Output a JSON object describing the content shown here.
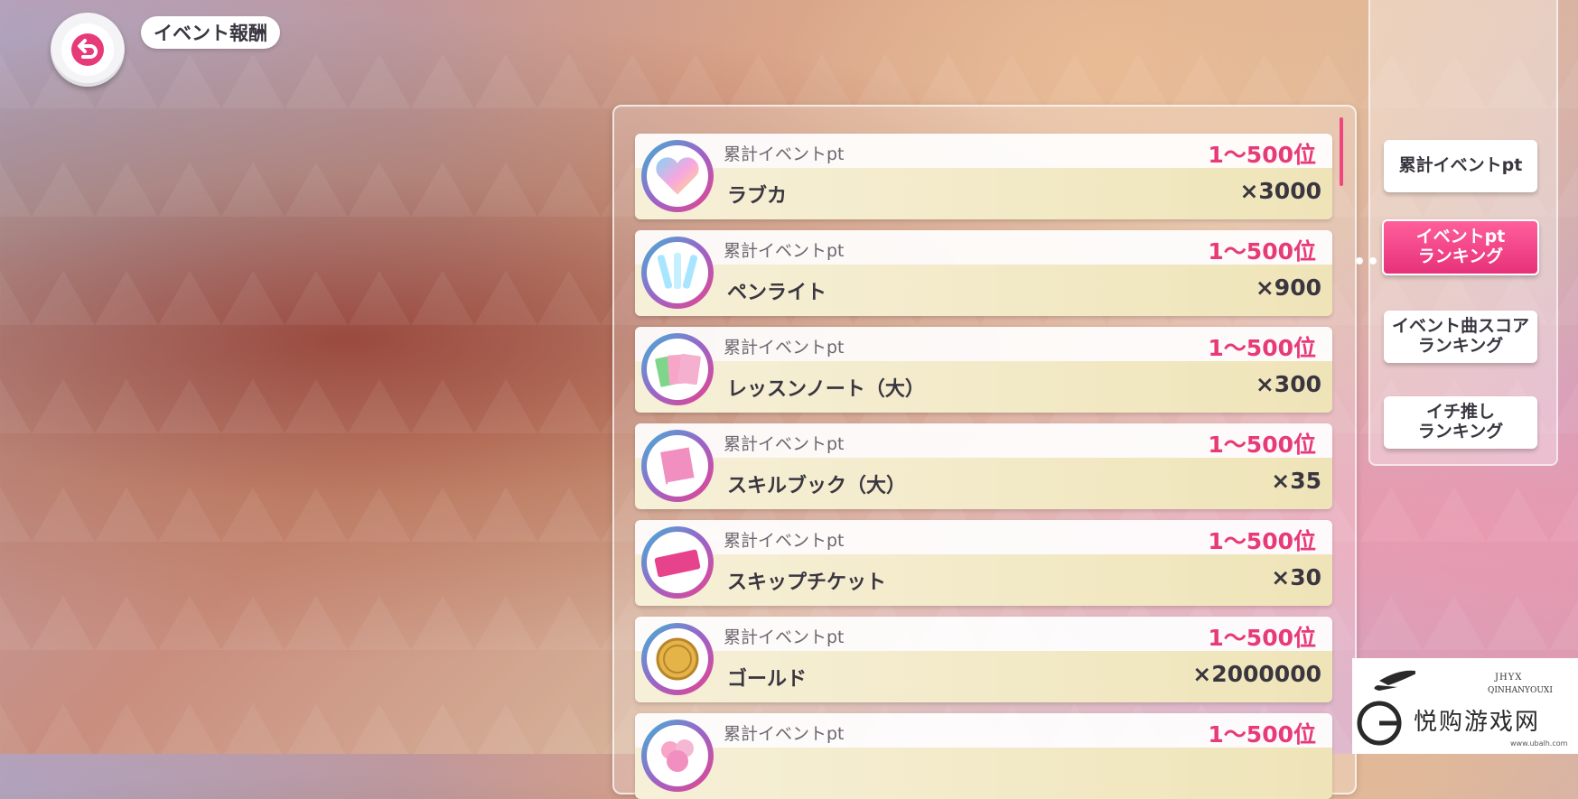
{
  "header": {
    "title": "イベント報酬"
  },
  "rewards": [
    {
      "label": "累計イベントpt",
      "rank": "1～500位",
      "name": "ラブカ",
      "qty": "×3000",
      "icon": "heart-gem-icon"
    },
    {
      "label": "累計イベントpt",
      "rank": "1～500位",
      "name": "ペンライト",
      "qty": "×900",
      "icon": "penlight-icon"
    },
    {
      "label": "累計イベントpt",
      "rank": "1～500位",
      "name": "レッスンノート（大）",
      "qty": "×300",
      "icon": "lesson-note-icon"
    },
    {
      "label": "累計イベントpt",
      "rank": "1～500位",
      "name": "スキルブック（大）",
      "qty": "×35",
      "icon": "skill-book-icon"
    },
    {
      "label": "累計イベントpt",
      "rank": "1～500位",
      "name": "スキップチケット",
      "qty": "×30",
      "icon": "skip-ticket-icon"
    },
    {
      "label": "累計イベントpt",
      "rank": "1～500位",
      "name": "ゴールド",
      "qty": "×2000000",
      "icon": "gold-coin-icon"
    },
    {
      "label": "累計イベントpt",
      "rank": "1～500位",
      "name": "",
      "qty": "",
      "icon": "pink-item-icon"
    }
  ],
  "tabs": [
    {
      "label": "累計イベントpt",
      "active": false
    },
    {
      "label_line1": "イベントpt",
      "label_line2": "ランキング",
      "active": true
    },
    {
      "label_line1": "イベント曲スコア",
      "label_line2": "ランキング",
      "active": false
    },
    {
      "label_line1": "イチ推し",
      "label_line2": "ランキング",
      "active": false
    }
  ],
  "watermark": {
    "brand_small": "JHYX",
    "brand_roman": "QINHANYOUXI",
    "brand_cn": "悦购游戏网",
    "url": "www.ubalh.com"
  },
  "colors": {
    "accent_pink": "#e73a78",
    "row_bottom": "#efe4b8"
  }
}
